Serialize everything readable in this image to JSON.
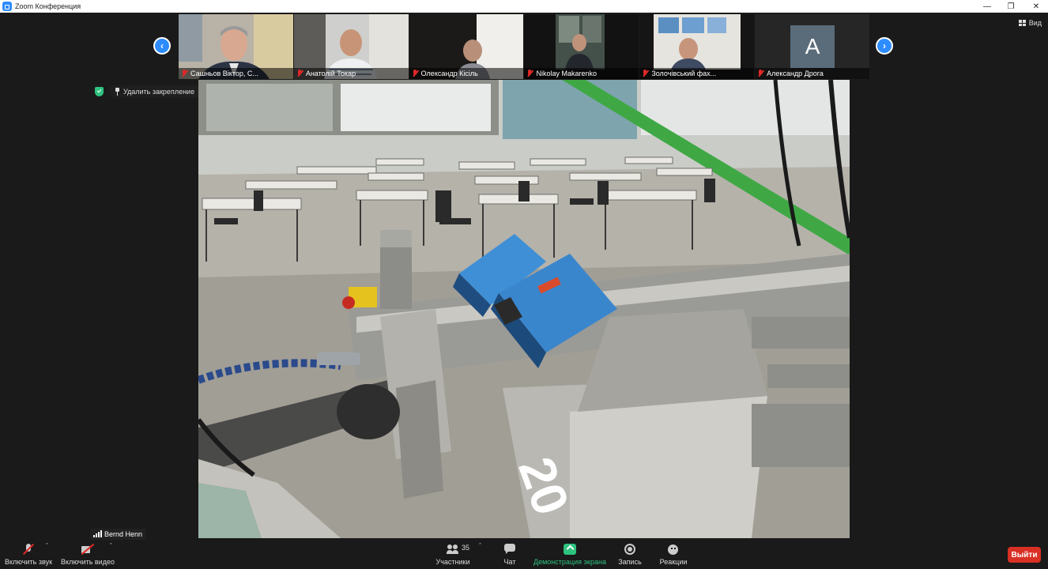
{
  "window": {
    "title": "Zoom Конференция"
  },
  "view_button": {
    "label": "Вид"
  },
  "participants_strip": [
    {
      "name": "Сашньов Віктор, С...",
      "muted": true
    },
    {
      "name": "Анатолій Токар",
      "muted": true
    },
    {
      "name": "Олександр Кісіль",
      "muted": true
    },
    {
      "name": "Nikolay Makarenko",
      "muted": true
    },
    {
      "name": "Золочівський фах...",
      "muted": true
    },
    {
      "name": "Александр Дрога",
      "muted": true,
      "avatar_letter": "A"
    }
  ],
  "pin_bar": {
    "unpin_label": "Удалить закрепление"
  },
  "active_speaker": {
    "name": "Bernd Henn"
  },
  "toolbar": {
    "audio_label": "Включить звук",
    "video_label": "Включить видео",
    "participants_label": "Участники",
    "participants_count": "35",
    "chat_label": "Чат",
    "share_label": "Демонстрация экрана",
    "record_label": "Запись",
    "reactions_label": "Реакции",
    "leave_label": "Выйти"
  },
  "colors": {
    "accent": "#2d8cff",
    "share_green": "#2ec27e",
    "leave_red": "#d93025"
  }
}
